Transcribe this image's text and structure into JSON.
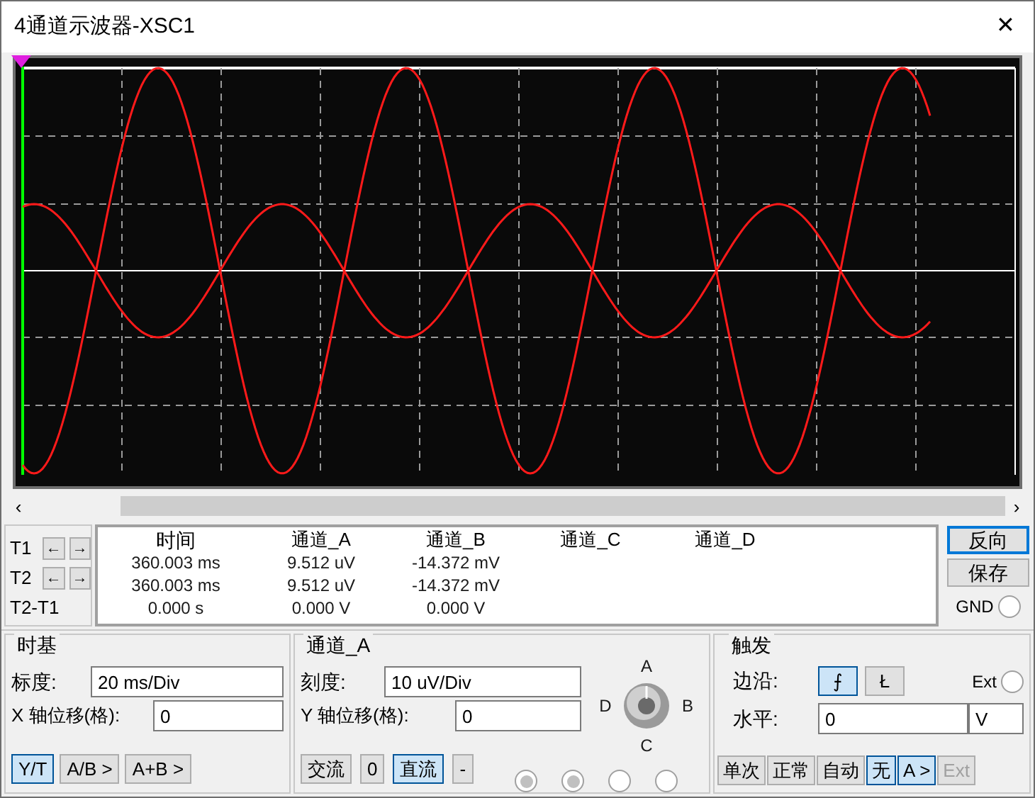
{
  "window": {
    "title": "4通道示波器-XSC1",
    "close": "✕"
  },
  "scroll": {
    "left": "‹",
    "right": "›"
  },
  "cursors": [
    {
      "label": "T1",
      "left": "←",
      "right": "→"
    },
    {
      "label": "T2",
      "left": "←",
      "right": "→"
    },
    {
      "label": "T2-T1"
    }
  ],
  "readout": {
    "columns": [
      "时间",
      "通道_A",
      "通道_B",
      "通道_C",
      "通道_D"
    ],
    "rows": [
      [
        "360.003 ms",
        "9.512 uV",
        "-14.372 mV"
      ],
      [
        "360.003 ms",
        "9.512 uV",
        "-14.372 mV"
      ],
      [
        "0.000 s",
        "0.000 V",
        "0.000 V"
      ]
    ]
  },
  "side_buttons": [
    {
      "label": "反向",
      "selected": true
    },
    {
      "label": "保存",
      "selected": false
    }
  ],
  "gnd": {
    "label": "GND",
    "checked": false
  },
  "timebase": {
    "title": "时基",
    "scale_label": "标度:",
    "scale": "20 ms/Div",
    "xpos_label": "X 轴位移(格):",
    "xpos": "0",
    "modes": [
      {
        "label": "Y/T",
        "selected": true
      },
      {
        "label": "A/B >",
        "selected": false
      },
      {
        "label": "A+B >",
        "selected": false
      }
    ]
  },
  "channel": {
    "title": "通道_A",
    "scale_label": "刻度:",
    "scale": "10 uV/Div",
    "ypos_label": "Y 轴位移(格):",
    "ypos": "0",
    "knob": {
      "top": "A",
      "right": "B",
      "bottom": "C",
      "left": "D"
    },
    "coupling": [
      {
        "label": "交流",
        "selected": false
      },
      {
        "label": "0",
        "selected": false
      },
      {
        "label": "直流",
        "selected": true
      },
      {
        "label": "-",
        "selected": false
      }
    ],
    "radios": [
      {
        "checked": true
      },
      {
        "checked": true
      },
      {
        "checked": false
      },
      {
        "checked": false
      }
    ]
  },
  "trigger": {
    "title": "触发",
    "edge_label": "边沿:",
    "edges": [
      {
        "label": "⨍",
        "selected": true
      },
      {
        "label": "Ł",
        "selected": false
      }
    ],
    "ext_label": "Ext",
    "ext_checked": false,
    "level_label": "水平:",
    "level": "0",
    "level_unit": "V",
    "modes": [
      {
        "label": "单次",
        "selected": false,
        "disabled": false
      },
      {
        "label": "正常",
        "selected": false,
        "disabled": false
      },
      {
        "label": "自动",
        "selected": false,
        "disabled": false
      },
      {
        "label": "无",
        "selected": true,
        "disabled": false
      },
      {
        "label": "A >",
        "selected": true,
        "disabled": false
      },
      {
        "label": "Ext",
        "selected": false,
        "disabled": true
      }
    ]
  }
}
